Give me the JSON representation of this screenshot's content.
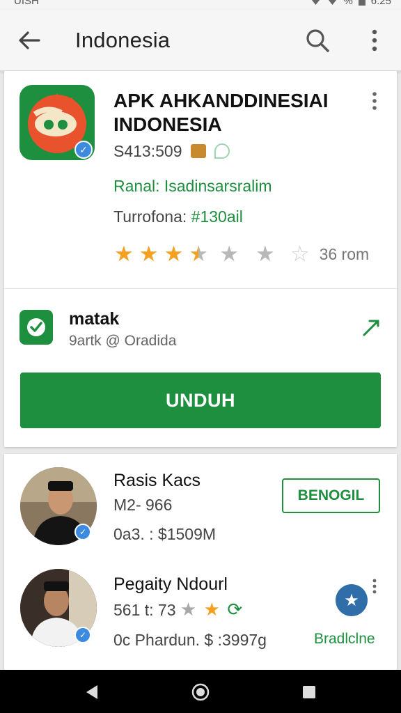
{
  "status_bar": {
    "carrier": "UISH",
    "battery": "%",
    "time": "6.25"
  },
  "app_bar": {
    "title": "Indonesia"
  },
  "app": {
    "title": "APK AHKANDDINESIAI INDONESIA",
    "size": "S413:509",
    "channel": "Ranal: Isadinsarsralim",
    "meta_label": "Turrofona:",
    "meta_value": "#130ail",
    "rating_count": "36 rom"
  },
  "developer": {
    "name": "matak",
    "sub": "9artk @ Oradida"
  },
  "install_button": "UNDUH",
  "rows": [
    {
      "title": "Rasis Kacs",
      "line1": "M2- 966",
      "line2": "0a3. : $1509M",
      "button": "BENOGIL"
    },
    {
      "title": "Pegaity Ndourl",
      "line1": "561 t: 73",
      "line2": "0c Phardun. $ :3997g",
      "link": "Bradlclne"
    }
  ],
  "colors": {
    "primary_green": "#1e8f3e",
    "star": "#f4a020",
    "badge_blue": "#3d8be0"
  }
}
